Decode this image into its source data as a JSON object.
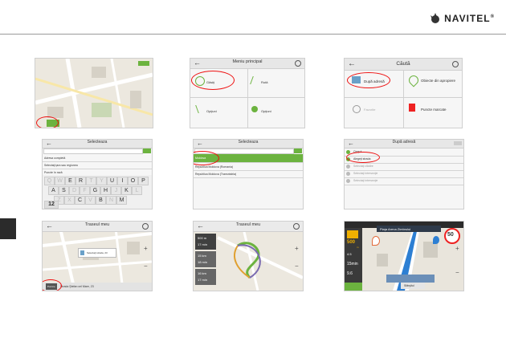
{
  "brand": {
    "name": "NAVITEL",
    "mark": "®"
  },
  "screens": {
    "s2": {
      "title": "Meniu principal",
      "items": [
        "Găsiţi",
        "Rută",
        "Opţiuni"
      ]
    },
    "s3": {
      "title": "Căută",
      "items": [
        "După adresă",
        "Obiecte din apropiere",
        "Favorite",
        "Puncte marcate"
      ]
    },
    "s4": {
      "title": "Selecteaza",
      "rows": [
        "Adresa completă",
        "Selectaţi ţara sau regiunea",
        "Puncte în rază"
      ]
    },
    "s5": {
      "title": "Selecteaza",
      "rows": [
        "Moldova",
        "Republica Moldova (Romania)",
        "Republica Moldova (Transnistria)"
      ]
    },
    "s6": {
      "title": "După adresă",
      "rows": [
        "Oraşul",
        "Alegeţi strada",
        "Selectaţi clădire",
        "Selectaţi intersecţie",
        "Selectaţi intersecţie"
      ]
    },
    "s7": {
      "title": "Traseul meu",
      "popup": "Selectaţi strada, 23",
      "start": "Pornire",
      "address": "Strada Ştefan cel Mare, 23"
    },
    "s8": {
      "title": "Traseul meu",
      "legs": [
        "500 m",
        "17 min",
        "15 km",
        "18 min",
        "16 km",
        "17 min"
      ]
    },
    "s9": {
      "street": "Piaţa Arena Zimbrului",
      "speed": "50",
      "dist": "500",
      "unit": "m",
      "eta": "15min",
      "km": "4.5",
      "total": "9.6",
      "next": "Sfârşitul"
    }
  },
  "keyboard": {
    "row1": [
      "Q",
      "W",
      "E",
      "R",
      "T",
      "Y",
      "U",
      "I",
      "O",
      "P"
    ],
    "row2": [
      "A",
      "S",
      "D",
      "F",
      "G",
      "H",
      "J",
      "K",
      "L"
    ],
    "row3": [
      "Z",
      "X",
      "C",
      "V",
      "B",
      "N",
      "M"
    ],
    "active": [
      "E",
      "R",
      "U",
      "I",
      "O",
      "P",
      "A",
      "S",
      "G",
      "H",
      "K",
      "C",
      "B",
      "M"
    ],
    "label_12": "12"
  }
}
